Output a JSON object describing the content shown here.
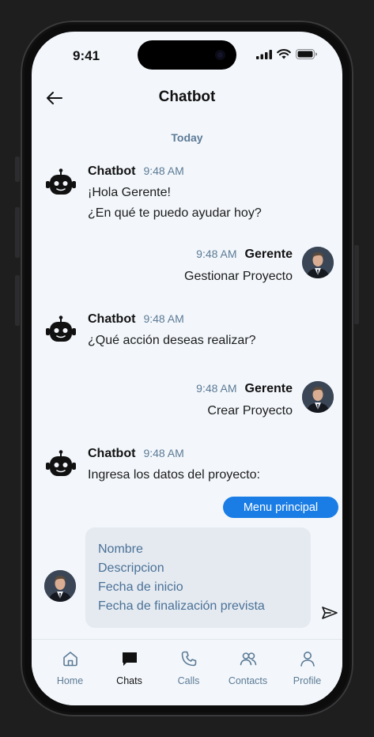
{
  "status": {
    "time": "9:41"
  },
  "header": {
    "title": "Chatbot"
  },
  "date_separator": "Today",
  "messages": [
    {
      "sender": "Chatbot",
      "time": "9:48 AM",
      "lines": [
        "¡Hola Gerente!",
        "¿En qué te puedo ayudar hoy?"
      ]
    },
    {
      "sender": "Gerente",
      "time": "9:48 AM",
      "lines": [
        "Gestionar Proyecto"
      ]
    },
    {
      "sender": "Chatbot",
      "time": "9:48 AM",
      "lines": [
        "¿Qué acción deseas realizar?"
      ]
    },
    {
      "sender": "Gerente",
      "time": "9:48 AM",
      "lines": [
        "Crear Proyecto"
      ]
    },
    {
      "sender": "Chatbot",
      "time": "9:48 AM",
      "lines": [
        "Ingresa los datos del proyecto:"
      ]
    }
  ],
  "menu_button": "Menu principal",
  "form": {
    "fields": [
      "Nombre",
      "Descripcion",
      "Fecha de inicio",
      "Fecha de finalización prevista"
    ]
  },
  "nav": {
    "items": [
      {
        "label": "Home",
        "icon": "home-icon"
      },
      {
        "label": "Chats",
        "icon": "chat-icon"
      },
      {
        "label": "Calls",
        "icon": "phone-icon"
      },
      {
        "label": "Contacts",
        "icon": "contacts-icon"
      },
      {
        "label": "Profile",
        "icon": "profile-icon"
      }
    ],
    "active": "Chats"
  },
  "colors": {
    "accent": "#1a7de6",
    "muted": "#5c7a96",
    "background": "#f3f7fb"
  }
}
